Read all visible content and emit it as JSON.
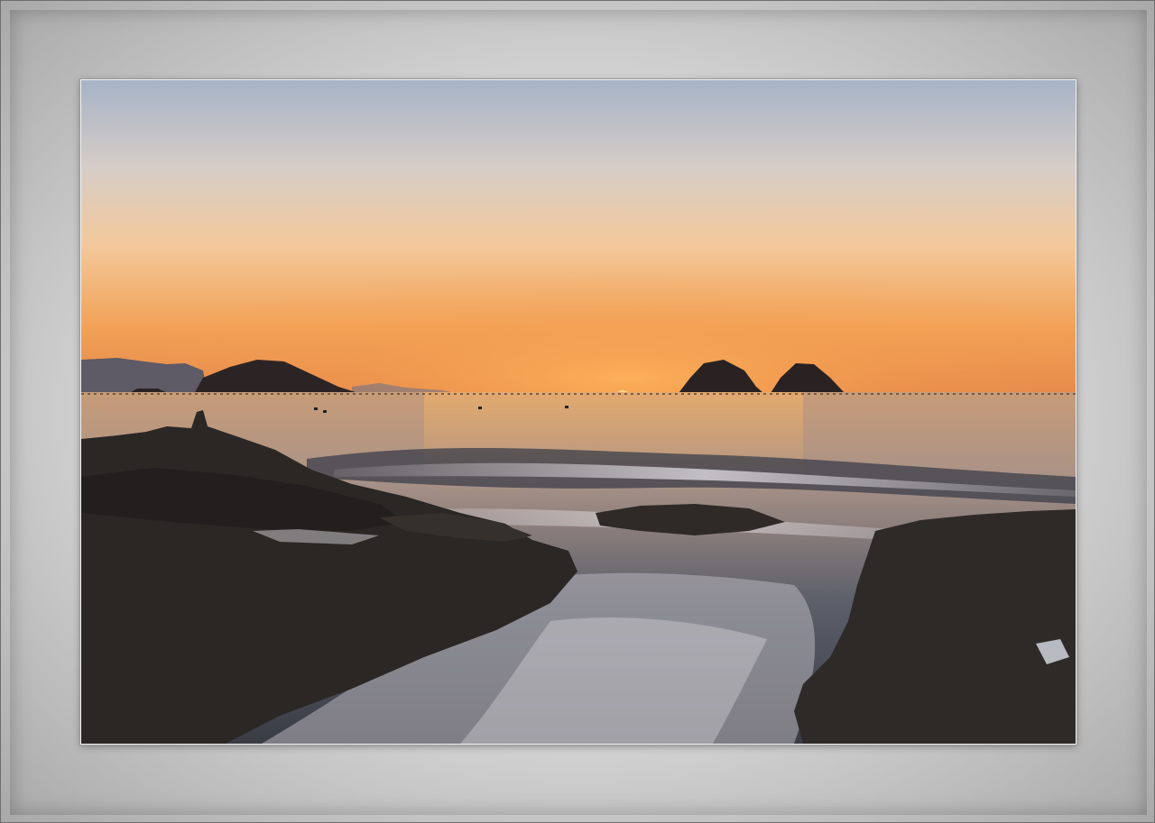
{
  "scene": {
    "subject": "photograph",
    "colors": {
      "sky_top": "#aab4c6",
      "sky_mid": "#f1c9a0",
      "sky_horizon": "#ef9a4c",
      "sun": "#ffd27a",
      "sea": "#b39a88",
      "rock": "#2a2624",
      "frame": "#d8d8d8"
    }
  }
}
